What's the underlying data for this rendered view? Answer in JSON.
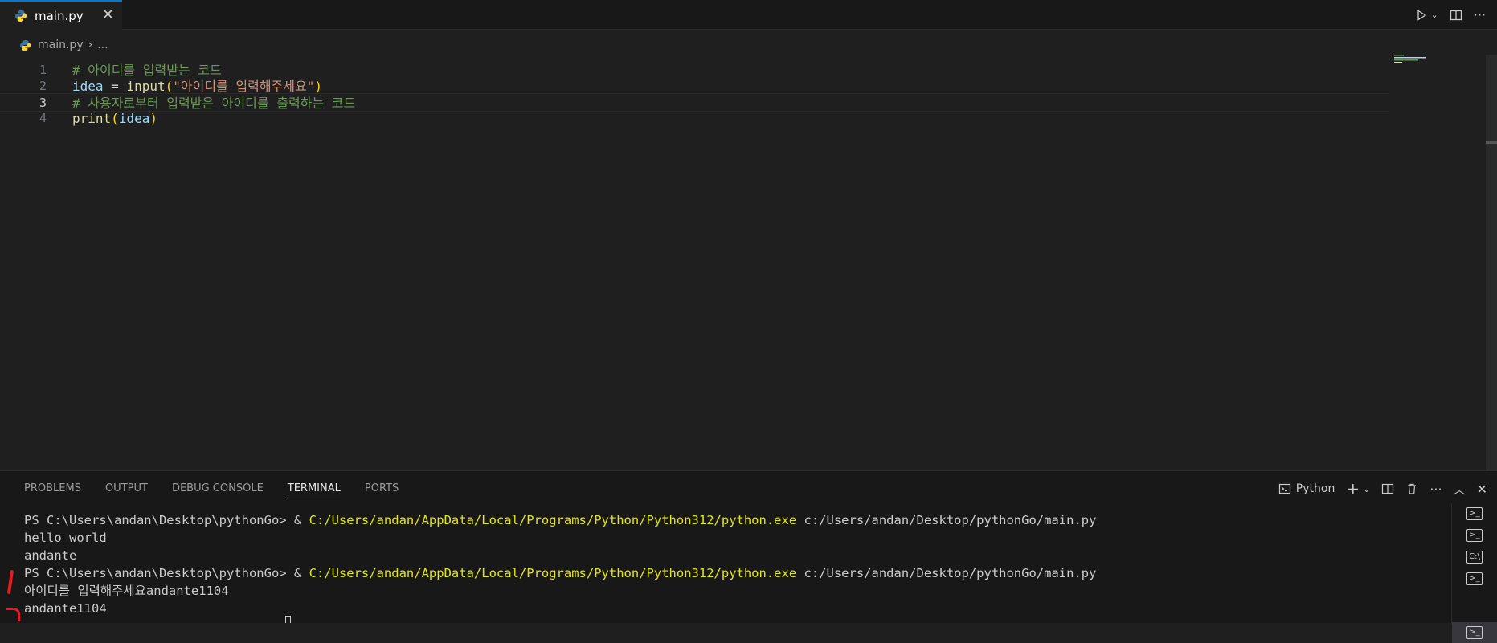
{
  "tab": {
    "filename": "main.py"
  },
  "breadcrumb": {
    "file": "main.py",
    "more": "..."
  },
  "editor": {
    "lines": [
      {
        "num": "1",
        "parts": [
          {
            "t": "# 아이디를 입력받는 코드",
            "c": "cmt"
          }
        ]
      },
      {
        "num": "2",
        "parts": [
          {
            "t": "idea",
            "c": "var"
          },
          {
            "t": " = ",
            "c": "pun"
          },
          {
            "t": "input",
            "c": "fn"
          },
          {
            "t": "(",
            "c": "par"
          },
          {
            "t": "\"아이디를 입력해주세요\"",
            "c": "str"
          },
          {
            "t": ")",
            "c": "par"
          }
        ]
      },
      {
        "num": "3",
        "parts": [
          {
            "t": "# 사용자로부터 입력받은 아이디를 출력하는 코드",
            "c": "cmt"
          }
        ]
      },
      {
        "num": "4",
        "parts": [
          {
            "t": "print",
            "c": "fn"
          },
          {
            "t": "(",
            "c": "par"
          },
          {
            "t": "idea",
            "c": "var"
          },
          {
            "t": ")",
            "c": "par"
          }
        ]
      }
    ],
    "current_line": 3
  },
  "panel": {
    "tabs": [
      "PROBLEMS",
      "OUTPUT",
      "DEBUG CONSOLE",
      "TERMINAL",
      "PORTS"
    ],
    "active_tab": "TERMINAL",
    "shell": "Python"
  },
  "terminal": {
    "lines": [
      [
        {
          "t": "PS C:\\Users\\andan\\Desktop\\pythonGo> & "
        },
        {
          "t": "C:/Users/andan/AppData/Local/Programs/Python/Python312/python.exe",
          "c": "term-yellow"
        },
        {
          "t": " c:/Users/andan/Desktop/pythonGo/main.py"
        }
      ],
      [
        {
          "t": "hello world"
        }
      ],
      [
        {
          "t": "andante"
        }
      ],
      [
        {
          "t": "PS C:\\Users\\andan\\Desktop\\pythonGo> & "
        },
        {
          "t": "C:/Users/andan/AppData/Local/Programs/Python/Python312/python.exe",
          "c": "term-yellow"
        },
        {
          "t": " c:/Users/andan/Desktop/pythonGo/main.py"
        }
      ],
      [
        {
          "t": "아이디를 입력해주세요andante1104"
        }
      ],
      [
        {
          "t": "andante1104"
        }
      ]
    ]
  },
  "colors": {
    "accent": "#0078d4",
    "background": "#1f1f1f",
    "annotation": "#e02020"
  }
}
